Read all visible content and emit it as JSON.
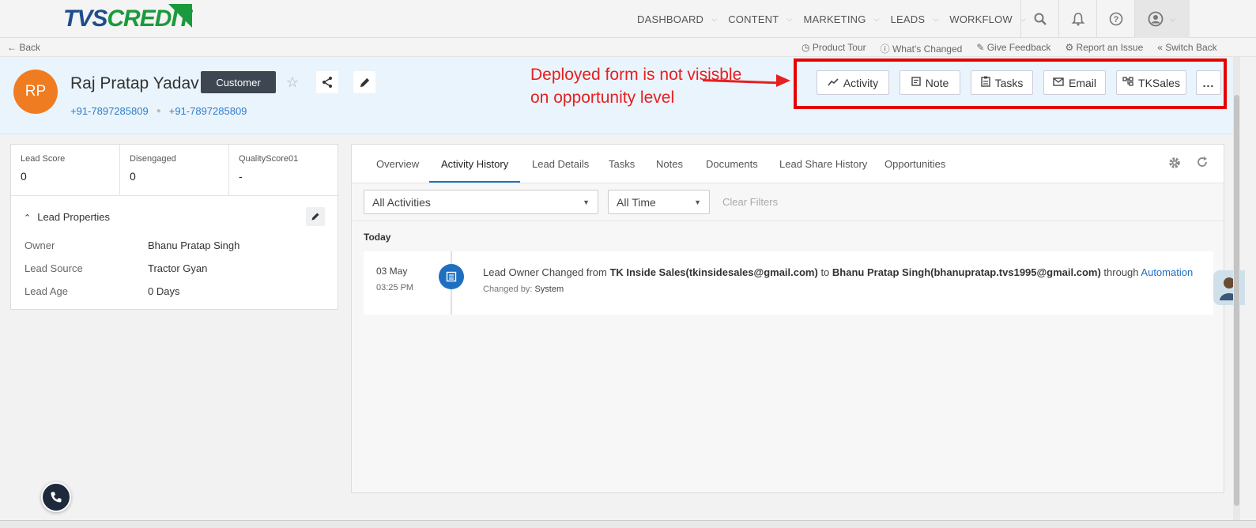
{
  "brand": {
    "part1": "TVS",
    "part2": "CREDIT"
  },
  "nav": {
    "items": [
      {
        "label": "DASHBOARD"
      },
      {
        "label": "CONTENT"
      },
      {
        "label": "MARKETING"
      },
      {
        "label": "LEADS"
      },
      {
        "label": "WORKFLOW"
      }
    ],
    "icons": [
      "search-icon",
      "bell-icon",
      "help-icon",
      "user-icon"
    ]
  },
  "subbar": {
    "back": "Back",
    "links": [
      "Product Tour",
      "What's Changed",
      "Give Feedback",
      "Report an Issue",
      "Switch Back"
    ]
  },
  "lead": {
    "initials": "RP",
    "name": "Raj Pratap Yadav",
    "badge": "Customer",
    "phone1": "+91-7897285809",
    "phone2": "+91-7897285809"
  },
  "annotation": {
    "line1": "Deployed form is not visisble",
    "line2": "on opportunity level"
  },
  "actions": [
    {
      "label": "Activity",
      "icon": "trend-icon"
    },
    {
      "label": "Note",
      "icon": "note-icon"
    },
    {
      "label": "Tasks",
      "icon": "clipboard-icon"
    },
    {
      "label": "Email",
      "icon": "mail-icon"
    },
    {
      "label": "TKSales",
      "icon": "hierarchy-icon"
    },
    {
      "label": "...",
      "icon": "more-icon"
    }
  ],
  "scores": [
    {
      "label": "Lead Score",
      "value": "0"
    },
    {
      "label": "Disengaged",
      "value": "0"
    },
    {
      "label": "QualityScore01",
      "value": "-"
    }
  ],
  "properties": {
    "title": "Lead Properties",
    "rows": [
      {
        "key": "Owner",
        "value": "Bhanu Pratap Singh"
      },
      {
        "key": "Lead Source",
        "value": "Tractor Gyan"
      },
      {
        "key": "Lead Age",
        "value": "0 Days"
      }
    ]
  },
  "tabs": [
    "Overview",
    "Activity History",
    "Lead Details",
    "Tasks",
    "Notes",
    "Documents",
    "Lead Share History",
    "Opportunities"
  ],
  "active_tab": "Activity History",
  "filters": {
    "activities": "All Activities",
    "time": "All Time",
    "clear": "Clear Filters"
  },
  "timeline": {
    "group": "Today",
    "entry": {
      "date": "03 May",
      "time": "03:25 PM",
      "prefix": "Lead Owner Changed from ",
      "from": "TK Inside Sales(tkinsidesales@gmail.com)",
      "mid": " to ",
      "to": "Bhanu Pratap Singh(bhanupratap.tvs1995@gmail.com)",
      "through": " through ",
      "via": "Automation",
      "changed_by_label": "Changed by: ",
      "changed_by": "System"
    }
  },
  "colors": {
    "brand_blue": "#1d4e8f",
    "brand_green": "#1a9a3c",
    "accent": "#1f6fc1",
    "avatar": "#f07c22",
    "annotation": "#e62020"
  }
}
